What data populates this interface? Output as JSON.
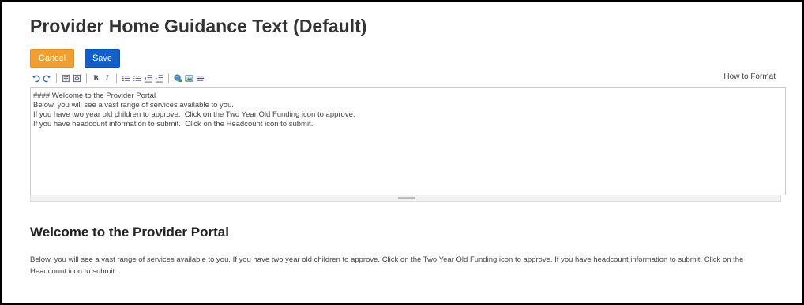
{
  "page": {
    "title": "Provider Home Guidance Text (Default)"
  },
  "actions": {
    "cancel_label": "Cancel",
    "save_label": "Save"
  },
  "toolbar": {
    "how_to_format_label": "How to Format",
    "bold_label": "B",
    "italic_label": "I",
    "icons": [
      "undo-icon",
      "redo-icon",
      "heading-icon",
      "code-icon",
      "bold-icon",
      "italic-icon",
      "bulleted-list-icon",
      "numbered-list-icon",
      "outdent-icon",
      "indent-icon",
      "link-icon",
      "image-icon",
      "horizontal-rule-icon"
    ]
  },
  "editor": {
    "lines": [
      "#### Welcome to the Provider Portal",
      "Below, you will see a vast range of services available to you.",
      "If you have two year old children to approve.  Click on the Two Year Old Funding icon to approve.",
      "If you have headcount information to submit.  Click on the Headcount icon to submit."
    ]
  },
  "preview": {
    "title": "Welcome to the Provider Portal",
    "body": "Below, you will see a vast range of services available to you. If you have two year old children to approve. Click on the Two Year Old Funding icon to approve. If you have headcount information to submit. Click on the Headcount icon to submit."
  },
  "colors": {
    "cancel": "#f0a030",
    "save": "#1060c8"
  }
}
